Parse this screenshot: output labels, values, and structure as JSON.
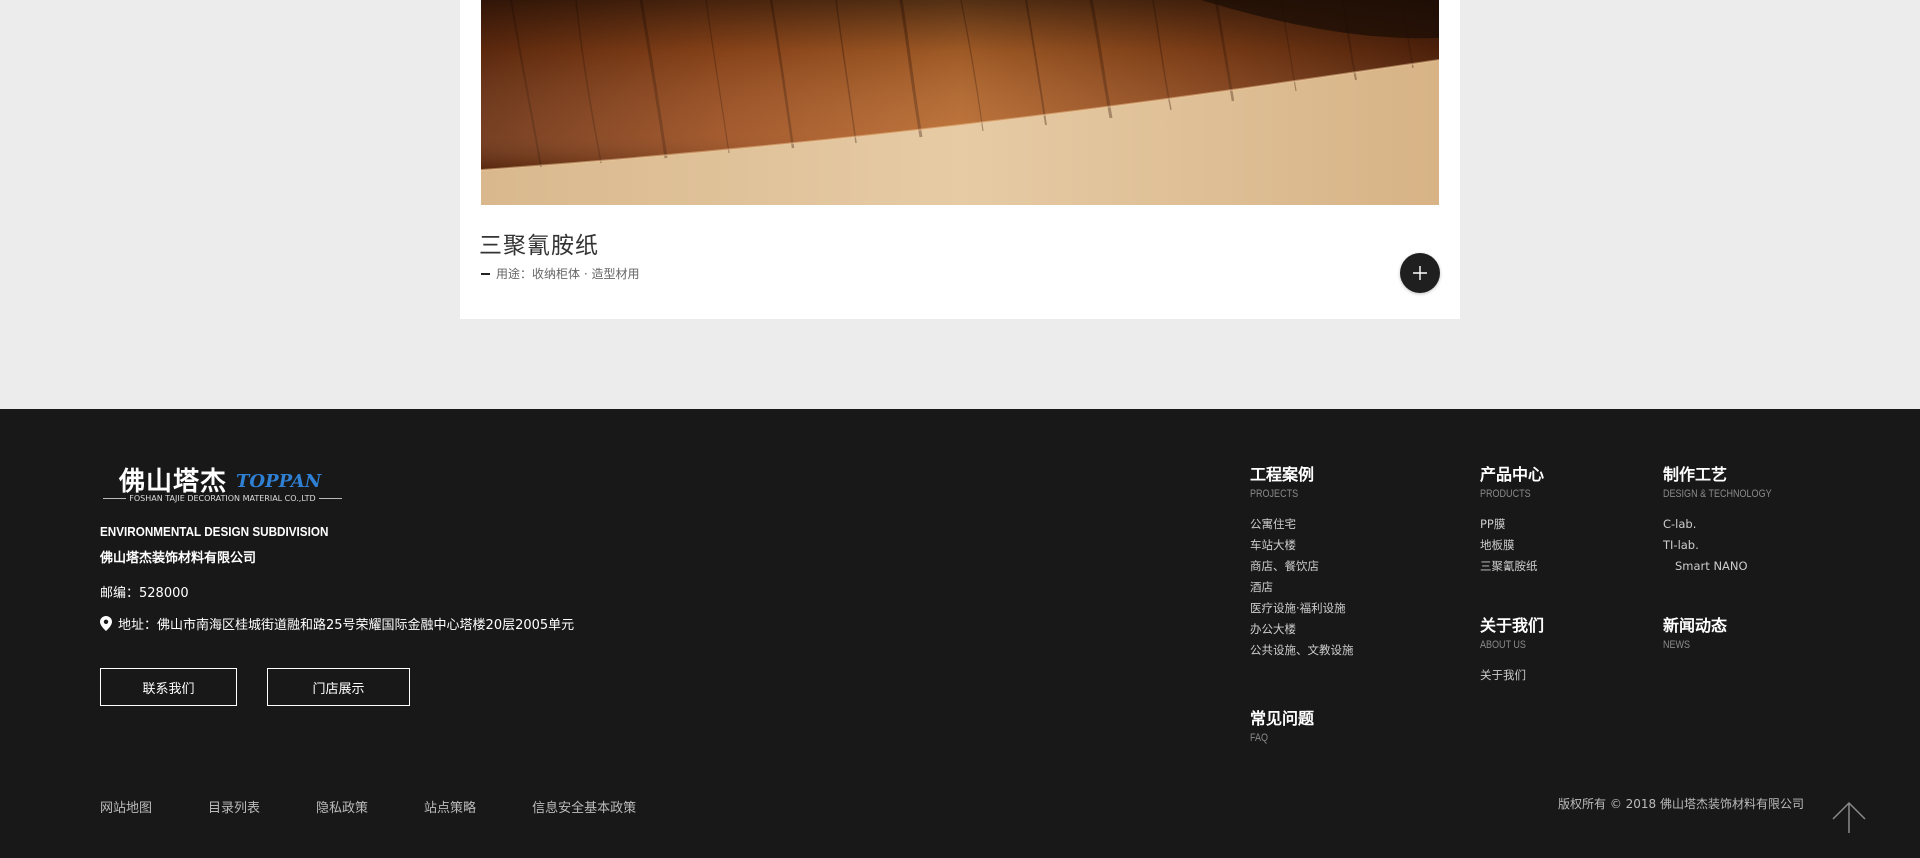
{
  "product_card": {
    "title": "三聚氰胺纸",
    "usage": "用途：收纳柜体 · 造型材用"
  },
  "footer": {
    "logo_cn": "佛山塔杰",
    "logo_en": "TOPPAN",
    "logo_sub": "FOSHAN TAJIE DECORATION MATERIAL CO.,LTD",
    "division": "ENVIRONMENTAL DESIGN SUBDIVISION",
    "company": "佛山塔杰装饰材料有限公司",
    "postcode": "邮编：528000",
    "address": "地址：佛山市南海区桂城街道融和路25号荣耀国际金融中心塔楼20层2005单元",
    "btn_contact": "联系我们",
    "btn_store": "门店展示",
    "columns": {
      "projects": {
        "title": "工程案例",
        "sub": "PROJECTS",
        "items": [
          "公寓住宅",
          "车站大楼",
          "商店、餐饮店",
          "酒店",
          "医疗设施·福利设施",
          "办公大楼",
          "公共设施、文教设施"
        ]
      },
      "products": {
        "title": "产品中心",
        "sub": "PRODUCTS",
        "items": [
          "PP膜",
          "地板膜",
          "三聚氰胺纸"
        ]
      },
      "technology": {
        "title": "制作工艺",
        "sub": "DESIGN & TECHNOLOGY",
        "items": [
          "C-lab.",
          "TI-lab.",
          "Smart NANO"
        ]
      },
      "about": {
        "title": "关于我们",
        "sub": "ABOUT US",
        "items": [
          "关于我们"
        ]
      },
      "news": {
        "title": "新闻动态",
        "sub": "NEWS"
      },
      "faq": {
        "title": "常见问题",
        "sub": "FAQ"
      }
    },
    "bottom_links": [
      "网站地图",
      "目录列表",
      "隐私政策",
      "站点策略",
      "信息安全基本政策"
    ],
    "copyright": "版权所有 © 2018 佛山塔杰装饰材料有限公司"
  }
}
